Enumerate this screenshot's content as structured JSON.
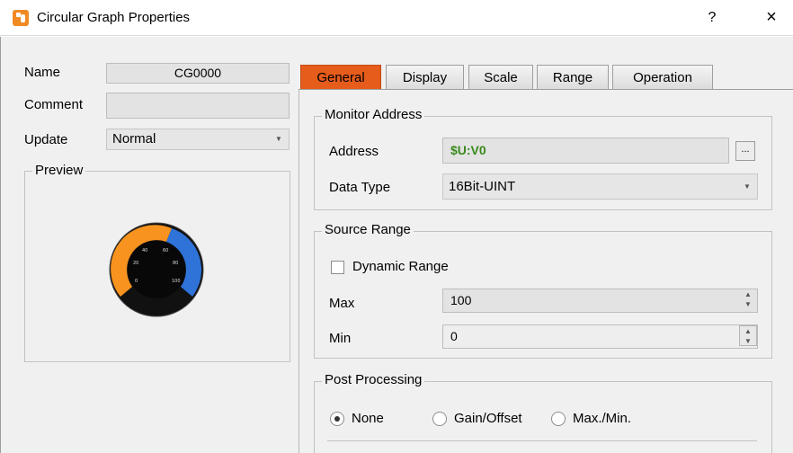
{
  "window": {
    "title": "Circular Graph Properties",
    "help": "?",
    "close": "×"
  },
  "left": {
    "name_label": "Name",
    "name_value": "CG0000",
    "comment_label": "Comment",
    "comment_value": "",
    "update_label": "Update",
    "update_value": "Normal",
    "preview_label": "Preview",
    "gauge_ticks": [
      "0",
      "20",
      "40",
      "60",
      "80",
      "100"
    ]
  },
  "tabs": [
    {
      "label": "General",
      "active": true
    },
    {
      "label": "Display",
      "active": false
    },
    {
      "label": "Scale",
      "active": false
    },
    {
      "label": "Range",
      "active": false
    },
    {
      "label": "Operation",
      "active": false
    }
  ],
  "monitor": {
    "title": "Monitor Address",
    "address_label": "Address",
    "address_value": "$U:V0",
    "address_button": "...",
    "datatype_label": "Data Type",
    "datatype_value": "16Bit-UINT"
  },
  "source": {
    "title": "Source Range",
    "dynamic_label": "Dynamic Range",
    "dynamic_checked": false,
    "max_label": "Max",
    "max_value": "100",
    "min_label": "Min",
    "min_value": "0"
  },
  "post": {
    "title": "Post Processing",
    "options": [
      {
        "label": "None",
        "selected": true
      },
      {
        "label": "Gain/Offset",
        "selected": false
      },
      {
        "label": "Max./Min.",
        "selected": false
      }
    ]
  },
  "colors": {
    "accent_tab": "#e65c1b",
    "address_text": "#3a8a1c",
    "gauge_orange": "#f7931e",
    "gauge_blue": "#2f73d9"
  }
}
